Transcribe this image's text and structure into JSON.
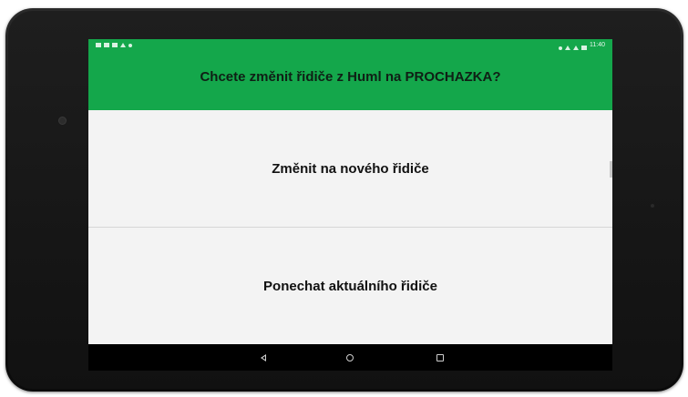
{
  "status_bar": {
    "time": "11:40",
    "left_icons": [
      "notification-icon",
      "notification-icon",
      "notification-icon",
      "warning-icon",
      "sync-icon"
    ],
    "right_icons": [
      "location-icon",
      "wifi-icon",
      "signal-icon",
      "battery-icon"
    ]
  },
  "dialog": {
    "title": "Chcete změnit řidiče z Huml na PROCHAZKA?",
    "option_change": "Změnit na nového řidiče",
    "option_keep": "Ponechat aktuálního řidiče"
  },
  "nav": {
    "back": "back-icon",
    "home": "home-icon",
    "recents": "recents-icon"
  },
  "colors": {
    "accent": "#14a74b",
    "option_background": "#f3f3f3",
    "bezel": "#141414"
  }
}
